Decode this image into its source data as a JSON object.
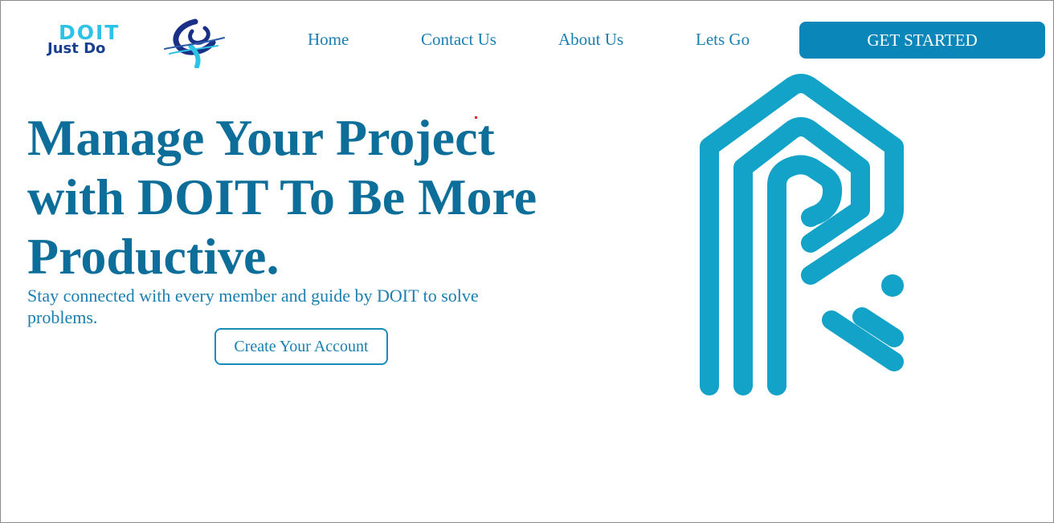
{
  "logo": {
    "word": "DOIT",
    "tagline": "Just Do"
  },
  "nav": {
    "items": [
      {
        "label": "Home"
      },
      {
        "label": "Contact Us"
      },
      {
        "label": "About Us"
      },
      {
        "label": "Lets Go"
      }
    ],
    "cta_label": "GET STARTED"
  },
  "hero": {
    "headline_lines": [
      "Manage Your Project",
      "with DOIT To Be More",
      "Productive."
    ],
    "subtext": "Stay connected with every member and guide by DOIT to solve problems.",
    "button_label": "Create Your Account"
  },
  "colors": {
    "brand_primary": "#0a87b8",
    "heading": "#0d6f99",
    "link": "#1a7fb0",
    "art": "#14a3c8"
  },
  "icons": {
    "logo_mark": "swirl-globe-icon",
    "hero_art": "maze-letter-r-icon"
  }
}
